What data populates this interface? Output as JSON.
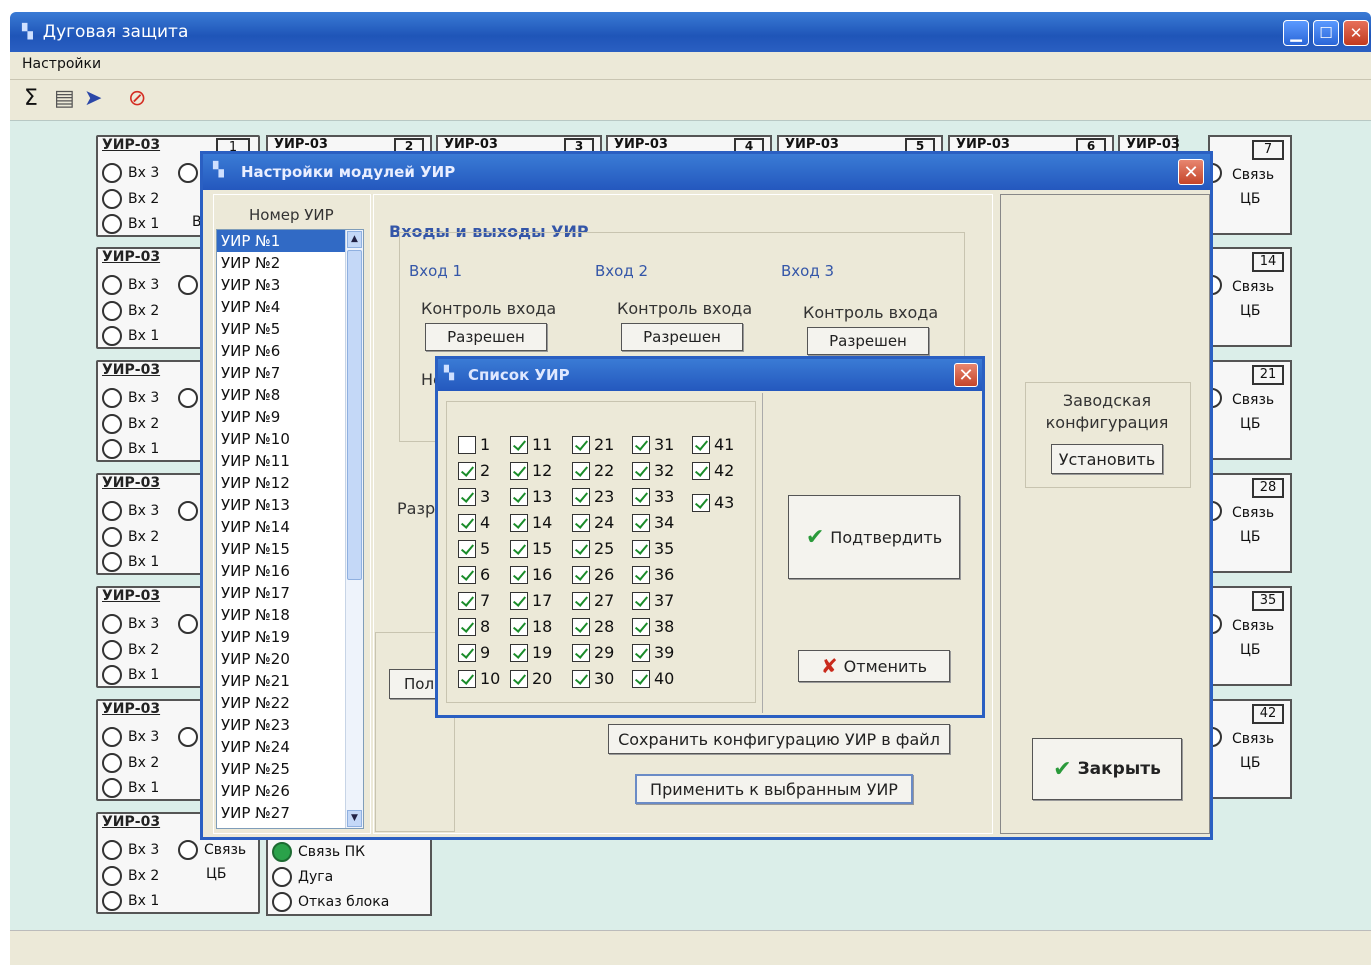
{
  "window": {
    "title": "Дуговая защита"
  },
  "menu": {
    "settings": "Настройки"
  },
  "toolbar": {
    "sum_icon": "Σ"
  },
  "blocks": {
    "uir_label": "УИР-03",
    "in3": "Вх 3",
    "in2": "Вх 2",
    "in1": "Вх 1",
    "link": "Связь",
    "cb": "ЦБ",
    "col2_partial": "В",
    "top_numbers": [
      "1",
      "2",
      "3",
      "4",
      "5",
      "6",
      "7"
    ],
    "right_numbers": [
      "14",
      "21",
      "28",
      "35",
      "42"
    ]
  },
  "status_block": {
    "pc_link": "Связь ПК",
    "arc": "Дуга",
    "failure": "Отказ блока"
  },
  "settings_dialog": {
    "title": "Настройки модулей УИР",
    "number_label": "Номер УИР",
    "list": [
      "УИР №1",
      "УИР №2",
      "УИР №3",
      "УИР №4",
      "УИР №5",
      "УИР №6",
      "УИР №7",
      "УИР №8",
      "УИР №9",
      "УИР №10",
      "УИР №11",
      "УИР №12",
      "УИР №13",
      "УИР №14",
      "УИР №15",
      "УИР №16",
      "УИР №17",
      "УИР №18",
      "УИР №19",
      "УИР №20",
      "УИР №21",
      "УИР №22",
      "УИР №23",
      "УИР №24",
      "УИР №25",
      "УИР №26",
      "УИР №27"
    ],
    "io_title": "Входы и выходы УИР",
    "input1": "Вход 1",
    "input2": "Вход 2",
    "input3": "Вход 3",
    "input_control": "Контроль входа",
    "allowed": "Разрешен",
    "partial_ne": "Не",
    "partial_razr": "Разр",
    "partial_pol": "Пол",
    "factory_config": "Заводская конфигурация",
    "install": "Установить",
    "save_config": "Сохранить конфигурацию УИР в файл",
    "apply_selected": "Применить к выбранным УИР",
    "close": "Закрыть"
  },
  "list_dialog": {
    "title": "Список УИР",
    "confirm": "Подтвердить",
    "cancel": "Отменить",
    "checkboxes": [
      {
        "label": "1",
        "checked": false
      },
      {
        "label": "2",
        "checked": true
      },
      {
        "label": "3",
        "checked": true
      },
      {
        "label": "4",
        "checked": true
      },
      {
        "label": "5",
        "checked": true
      },
      {
        "label": "6",
        "checked": true
      },
      {
        "label": "7",
        "checked": true
      },
      {
        "label": "8",
        "checked": true
      },
      {
        "label": "9",
        "checked": true
      },
      {
        "label": "10",
        "checked": true
      },
      {
        "label": "11",
        "checked": true
      },
      {
        "label": "12",
        "checked": true
      },
      {
        "label": "13",
        "checked": true
      },
      {
        "label": "14",
        "checked": true
      },
      {
        "label": "15",
        "checked": true
      },
      {
        "label": "16",
        "checked": true
      },
      {
        "label": "17",
        "checked": true
      },
      {
        "label": "18",
        "checked": true
      },
      {
        "label": "19",
        "checked": true
      },
      {
        "label": "20",
        "checked": true
      },
      {
        "label": "21",
        "checked": true
      },
      {
        "label": "22",
        "checked": true
      },
      {
        "label": "23",
        "checked": true
      },
      {
        "label": "24",
        "checked": true
      },
      {
        "label": "25",
        "checked": true
      },
      {
        "label": "26",
        "checked": true
      },
      {
        "label": "27",
        "checked": true
      },
      {
        "label": "28",
        "checked": true
      },
      {
        "label": "29",
        "checked": true
      },
      {
        "label": "30",
        "checked": true
      },
      {
        "label": "31",
        "checked": true
      },
      {
        "label": "32",
        "checked": true
      },
      {
        "label": "33",
        "checked": true
      },
      {
        "label": "34",
        "checked": true
      },
      {
        "label": "35",
        "checked": true
      },
      {
        "label": "36",
        "checked": true
      },
      {
        "label": "37",
        "checked": true
      },
      {
        "label": "38",
        "checked": true
      },
      {
        "label": "39",
        "checked": true
      },
      {
        "label": "40",
        "checked": true
      },
      {
        "label": "41",
        "checked": true
      },
      {
        "label": "42",
        "checked": true
      },
      {
        "label": "43",
        "checked": true
      }
    ]
  }
}
